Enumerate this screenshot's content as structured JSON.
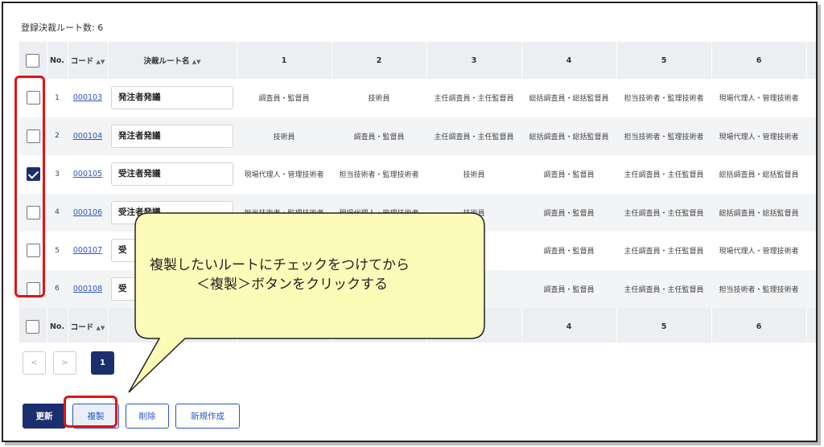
{
  "summary": {
    "count_label": "登録決裁ルート数: 6"
  },
  "table": {
    "headers": {
      "no": "No.",
      "code": "コード",
      "name": "決裁ルート名",
      "steps": [
        "1",
        "2",
        "3",
        "4",
        "5",
        "6"
      ]
    },
    "rows": [
      {
        "checked": false,
        "no": "1",
        "code": "000103",
        "name": "発注者発議",
        "cells": [
          "調査員・監督員",
          "技術員",
          "主任調査員・主任監督員",
          "総括調査員・総括監督員",
          "担当技術者・監理技術者",
          "現場代理人・管理技術者"
        ]
      },
      {
        "checked": false,
        "no": "2",
        "code": "000104",
        "name": "発注者発議",
        "cells": [
          "技術員",
          "調査員・監督員",
          "主任調査員・主任監督員",
          "総括調査員・総括監督員",
          "担当技術者・監理技術者",
          "現場代理人・管理技術者"
        ]
      },
      {
        "checked": true,
        "no": "3",
        "code": "000105",
        "name": "受注者発議",
        "cells": [
          "現場代理人・管理技術者",
          "担当技術者・監理技術者",
          "技術員",
          "調査員・監督員",
          "主任調査員・主任監督員",
          "総括調査員・総括監督員"
        ]
      },
      {
        "checked": false,
        "no": "4",
        "code": "000106",
        "name": "受注者発議",
        "cells": [
          "担当技術者・監理技術者",
          "現場代理人・管理技術者",
          "技術員",
          "調査員・監督員",
          "主任調査員・主任監督員",
          "総括調査員・総括監督員"
        ]
      },
      {
        "checked": false,
        "no": "5",
        "code": "000107",
        "name": "受",
        "cells": [
          "",
          "",
          "員",
          "調査員・監督員",
          "主任調査員・主任監督員",
          "現場代理人・管理技術者"
        ]
      },
      {
        "checked": false,
        "no": "6",
        "code": "000108",
        "name": "受",
        "cells": [
          "",
          "",
          "員",
          "調査員・監督員",
          "主任調査員・主任監督員",
          "担当技術者・監理技術者"
        ]
      }
    ],
    "footer": {
      "no": "No.",
      "code": "コード",
      "steps": [
        "4",
        "5",
        "6"
      ]
    }
  },
  "pagination": {
    "prev": "<",
    "next": ">",
    "current": "1"
  },
  "actions": {
    "update": "更新",
    "copy": "複製",
    "delete": "削除",
    "create": "新規作成"
  },
  "callout": {
    "line1": "複製したいルートにチェックをつけてから",
    "line2": "＜複製＞ボタンをクリックする"
  },
  "colors": {
    "primary": "#1b2f6e",
    "link": "#2a55c8",
    "highlight": "#e21414",
    "callout_fill": "#fdfbb8"
  }
}
